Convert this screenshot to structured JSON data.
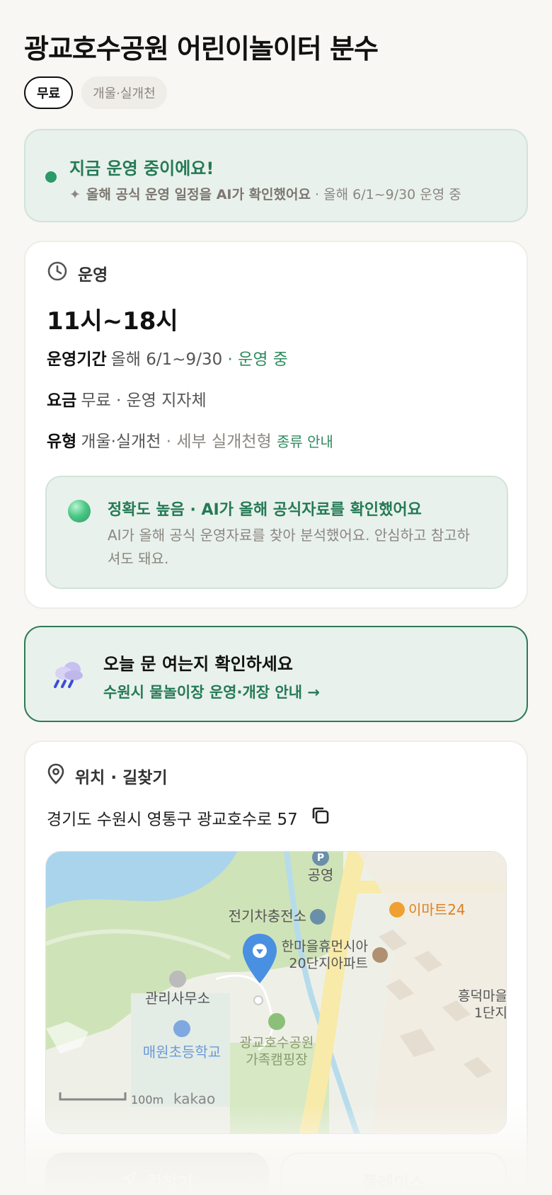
{
  "page": {
    "title": "광교호수공원 어린이놀이터 분수",
    "chips": [
      "무료",
      "개울·실개천"
    ]
  },
  "status": {
    "title": "지금 운영 중이에요!",
    "sub_bold": "올해 공식 운영 일정을 AI가 확인했어요",
    "sub_rest": " · 올해 6/1~9/30 운영 중"
  },
  "operation": {
    "heading": "운영",
    "hours": "11시~18시",
    "period_label": "운영기간",
    "period_value": "올해 6/1~9/30",
    "period_sep": " · ",
    "period_status": "운영 중",
    "fee_label": "요금",
    "fee_value": "무료 · 운영 지자체",
    "type_label": "유형",
    "type_value": "개울·실개천",
    "type_sep": " · ",
    "type_detail": "세부 실개천형",
    "type_link": "종류 안내",
    "accuracy_title": "정확도 높음 · AI가 올해 공식자료를 확인했어요",
    "accuracy_desc": "AI가 올해 공식 운영자료를 찾아 분석했어요. 안심하고 참고하셔도 돼요."
  },
  "check": {
    "title": "오늘 문 여는지 확인하세요",
    "link": "수원시 물놀이장 운영·개장 안내 →"
  },
  "location": {
    "heading": "위치 · 길찾기",
    "address": "경기도 수원시 영통구 광교호수로 57",
    "map_labels": {
      "parking": "공영",
      "ev": "전기차충전소",
      "mart": "이마트24",
      "apt1": "한마을휴먼시아",
      "apt2": "20단지아파트",
      "office": "관리사무소",
      "school": "매원초등학교",
      "camp1": "광교호수공원",
      "camp2": "가족캠핑장",
      "heung1": "흥덕마을",
      "heung2": "1단지",
      "scale": "100m",
      "brand": "kakao"
    },
    "btn_directions": "길찾기",
    "btn_place": "플레이스"
  },
  "colors": {
    "accent_green": "#2f8a5e",
    "status_bg": "#e9f1ec",
    "pin_blue": "#4a90e2"
  }
}
